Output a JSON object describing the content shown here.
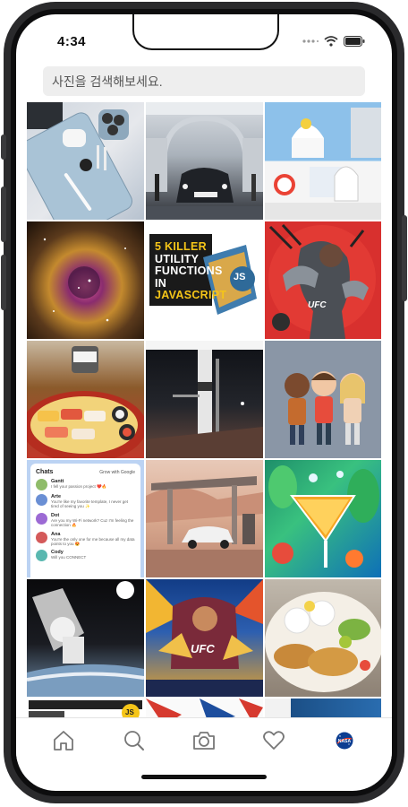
{
  "status_bar": {
    "time": "4:34"
  },
  "search": {
    "placeholder": "사진을 검색해보세요."
  },
  "tiles": [
    {
      "name": "tile-iphone-airpods",
      "interactable": true
    },
    {
      "name": "tile-tesla-showroom",
      "interactable": true
    },
    {
      "name": "tile-google-android-statues",
      "interactable": true
    },
    {
      "name": "tile-nebula",
      "interactable": true
    },
    {
      "name": "tile-js-utility-functions",
      "caption_lines": [
        "5 KILLER",
        "UTILITY",
        "FUNCTIONS",
        "IN",
        "JAVASCRIPT"
      ],
      "badge": "JS",
      "interactable": true
    },
    {
      "name": "tile-ufc-fighter-art",
      "caption": "UFC",
      "interactable": true
    },
    {
      "name": "tile-sushi-platter",
      "interactable": true
    },
    {
      "name": "tile-rocket-launchpad",
      "interactable": true
    },
    {
      "name": "tile-cartoon-characters",
      "interactable": true
    },
    {
      "name": "tile-chats-mockup",
      "interactable": true
    },
    {
      "name": "tile-desert-gas-station",
      "interactable": true
    },
    {
      "name": "tile-cocktail-splash",
      "interactable": true
    },
    {
      "name": "tile-astronaut-spacewalk",
      "interactable": true
    },
    {
      "name": "tile-ufc-poster",
      "caption": "UFC",
      "interactable": true
    },
    {
      "name": "tile-rice-plate",
      "interactable": true
    },
    {
      "name": "tile-js-partial",
      "badge": "JS",
      "interactable": true
    },
    {
      "name": "tile-poster-partial",
      "interactable": true
    },
    {
      "name": "tile-blue-partial",
      "interactable": true
    }
  ],
  "chats_mock": {
    "title": "Chats",
    "brand": "Grow with Google",
    "entries": [
      {
        "name": "Gantt",
        "message": "I fell your passion project ❤️🔥"
      },
      {
        "name": "Arte",
        "message": "You're like my favorite template, I never get tired of seeing you ✨"
      },
      {
        "name": "Dot",
        "message": "Are you my Wi-Fi network? Cuz I'm feeling the connection 🔥"
      },
      {
        "name": "Ana",
        "message": "You're the only one for me because all my data points to you 😍"
      },
      {
        "name": "Cody",
        "message": "Will you CONNECT"
      }
    ]
  },
  "tabbar": [
    {
      "name": "tab-home",
      "icon": "home-icon"
    },
    {
      "name": "tab-search",
      "icon": "search-icon"
    },
    {
      "name": "tab-camera",
      "icon": "camera-icon"
    },
    {
      "name": "tab-activity",
      "icon": "heart-icon"
    },
    {
      "name": "tab-profile",
      "icon": "nasa-avatar-icon",
      "label": "NASA"
    }
  ],
  "colors": {
    "tab_icon": "#777777",
    "search_bg": "#eeeeee"
  }
}
